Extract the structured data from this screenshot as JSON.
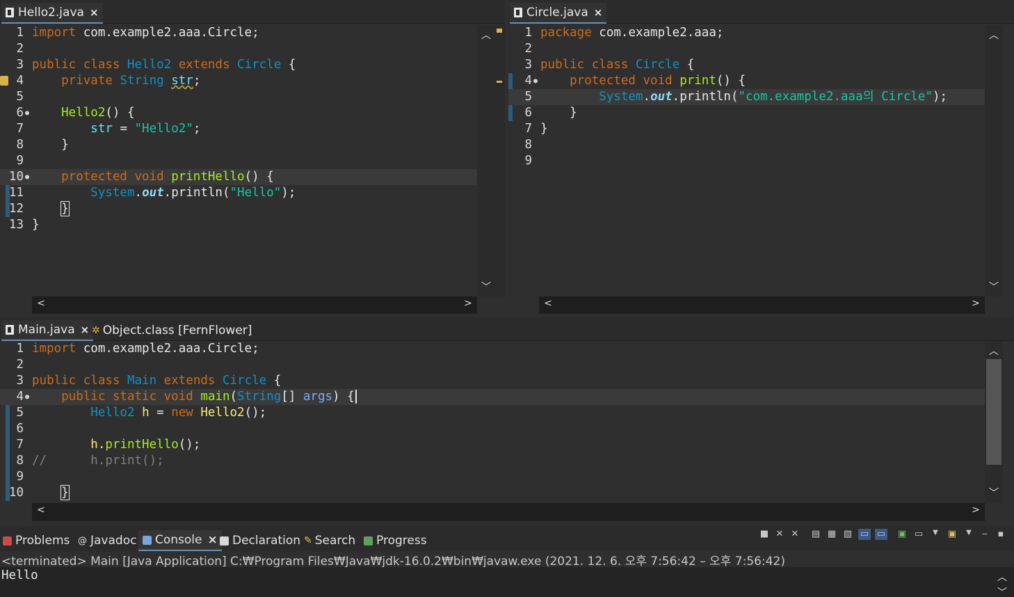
{
  "editors": {
    "hello2": {
      "tab_label": "Hello2.java",
      "lines": [
        "1",
        "2",
        "3",
        "4",
        "5",
        "6",
        "7",
        "8",
        "9",
        "10",
        "11",
        "12",
        "13"
      ]
    },
    "circle": {
      "tab_label": "Circle.java",
      "lines": [
        "1",
        "2",
        "3",
        "4",
        "5",
        "6",
        "7",
        "8",
        "9"
      ]
    },
    "main": {
      "tab_label": "Main.java",
      "tab2_label": "Object.class [FernFlower]",
      "lines": [
        "1",
        "2",
        "3",
        "4",
        "5",
        "6",
        "7",
        "8",
        "9",
        "10"
      ]
    }
  },
  "code": {
    "h1_import": "import",
    "h1_rest": " com.example2.aaa.Circle;",
    "h3_public": "public",
    "h3_class": " class ",
    "h3_name": "Hello2",
    "h3_extends": " extends ",
    "h3_super": "Circle",
    "h3_brace": " {",
    "h4_private": "    private",
    "h4_type": " String",
    "h4_sp": " ",
    "h4_field": "str",
    "h4_semi": ";",
    "h6_ctor": "    Hello2",
    "h6_rest": "() {",
    "h7_field": "        str",
    "h7_eq": " = ",
    "h7_str": "\"Hello2\"",
    "h7_semi": ";",
    "h8": "    }",
    "h10_mod": "    protected void",
    "h10_sp": " ",
    "h10_fn": "printHello",
    "h10_rest": "() {",
    "h11_sys": "        System",
    "h11_dot": ".",
    "h11_out": "out",
    "h11_call": ".println(",
    "h11_str": "\"Hello\"",
    "h11_end": ");",
    "h12_pad": "    ",
    "h12_brace": "}",
    "h13": "}",
    "c1_pkg": "package",
    "c1_rest": " com.example2.aaa;",
    "c3_public": "public",
    "c3_class": " class ",
    "c3_name": "Circle",
    "c3_brace": " {",
    "c4_mod": "    protected void",
    "c4_sp": " ",
    "c4_fn": "print",
    "c4_rest": "() {",
    "c5_sys": "        System",
    "c5_dot": ".",
    "c5_out": "out",
    "c5_call": ".println(",
    "c5_str": "\"com.example2.aaa의 Circle\"",
    "c5_end": ");",
    "c6": "    }",
    "c7": "}",
    "m1_import": "import",
    "m1_rest": " com.example2.aaa.Circle;",
    "m3_public": "public",
    "m3_class": " class ",
    "m3_name": "Main",
    "m3_extends": " extends ",
    "m3_super": "Circle",
    "m3_brace": " {",
    "m4_mods": "    public static void",
    "m4_sp": " ",
    "m4_fn": "main",
    "m4_p1": "(",
    "m4_type": "String",
    "m4_arr": "[] ",
    "m4_args": "args",
    "m4_end": ") {",
    "m5_type": "        Hello2",
    "m5_sp": " ",
    "m5_var": "h",
    "m5_eq": " = ",
    "m5_new": "new",
    "m5_sp2": " ",
    "m5_ctor": "Hello2",
    "m5_end": "();",
    "m7_var": "        h",
    "m7_dot": ".",
    "m7_fn": "printHello",
    "m7_end": "();",
    "m8_cmt": "//      h.print();",
    "m10_pad": "    ",
    "m10_brace": "}"
  },
  "console": {
    "tabs": [
      "Problems",
      "Javadoc",
      "Console",
      "Declaration",
      "Search",
      "Progress"
    ],
    "status": "<terminated> Main [Java Application] C:₩Program Files₩Java₩jdk-16.0.2₩bin₩javaw.exe  (2021. 12. 6. 오후 7:56:42 – 오후 7:56:42)",
    "output": "Hello"
  },
  "colors": {
    "keyword": "#cc6c1d",
    "type": "#1290c3",
    "method": "#a7ec21",
    "string": "#17c6a3",
    "field": "#66e1f8",
    "background": "#2f2f2f"
  }
}
